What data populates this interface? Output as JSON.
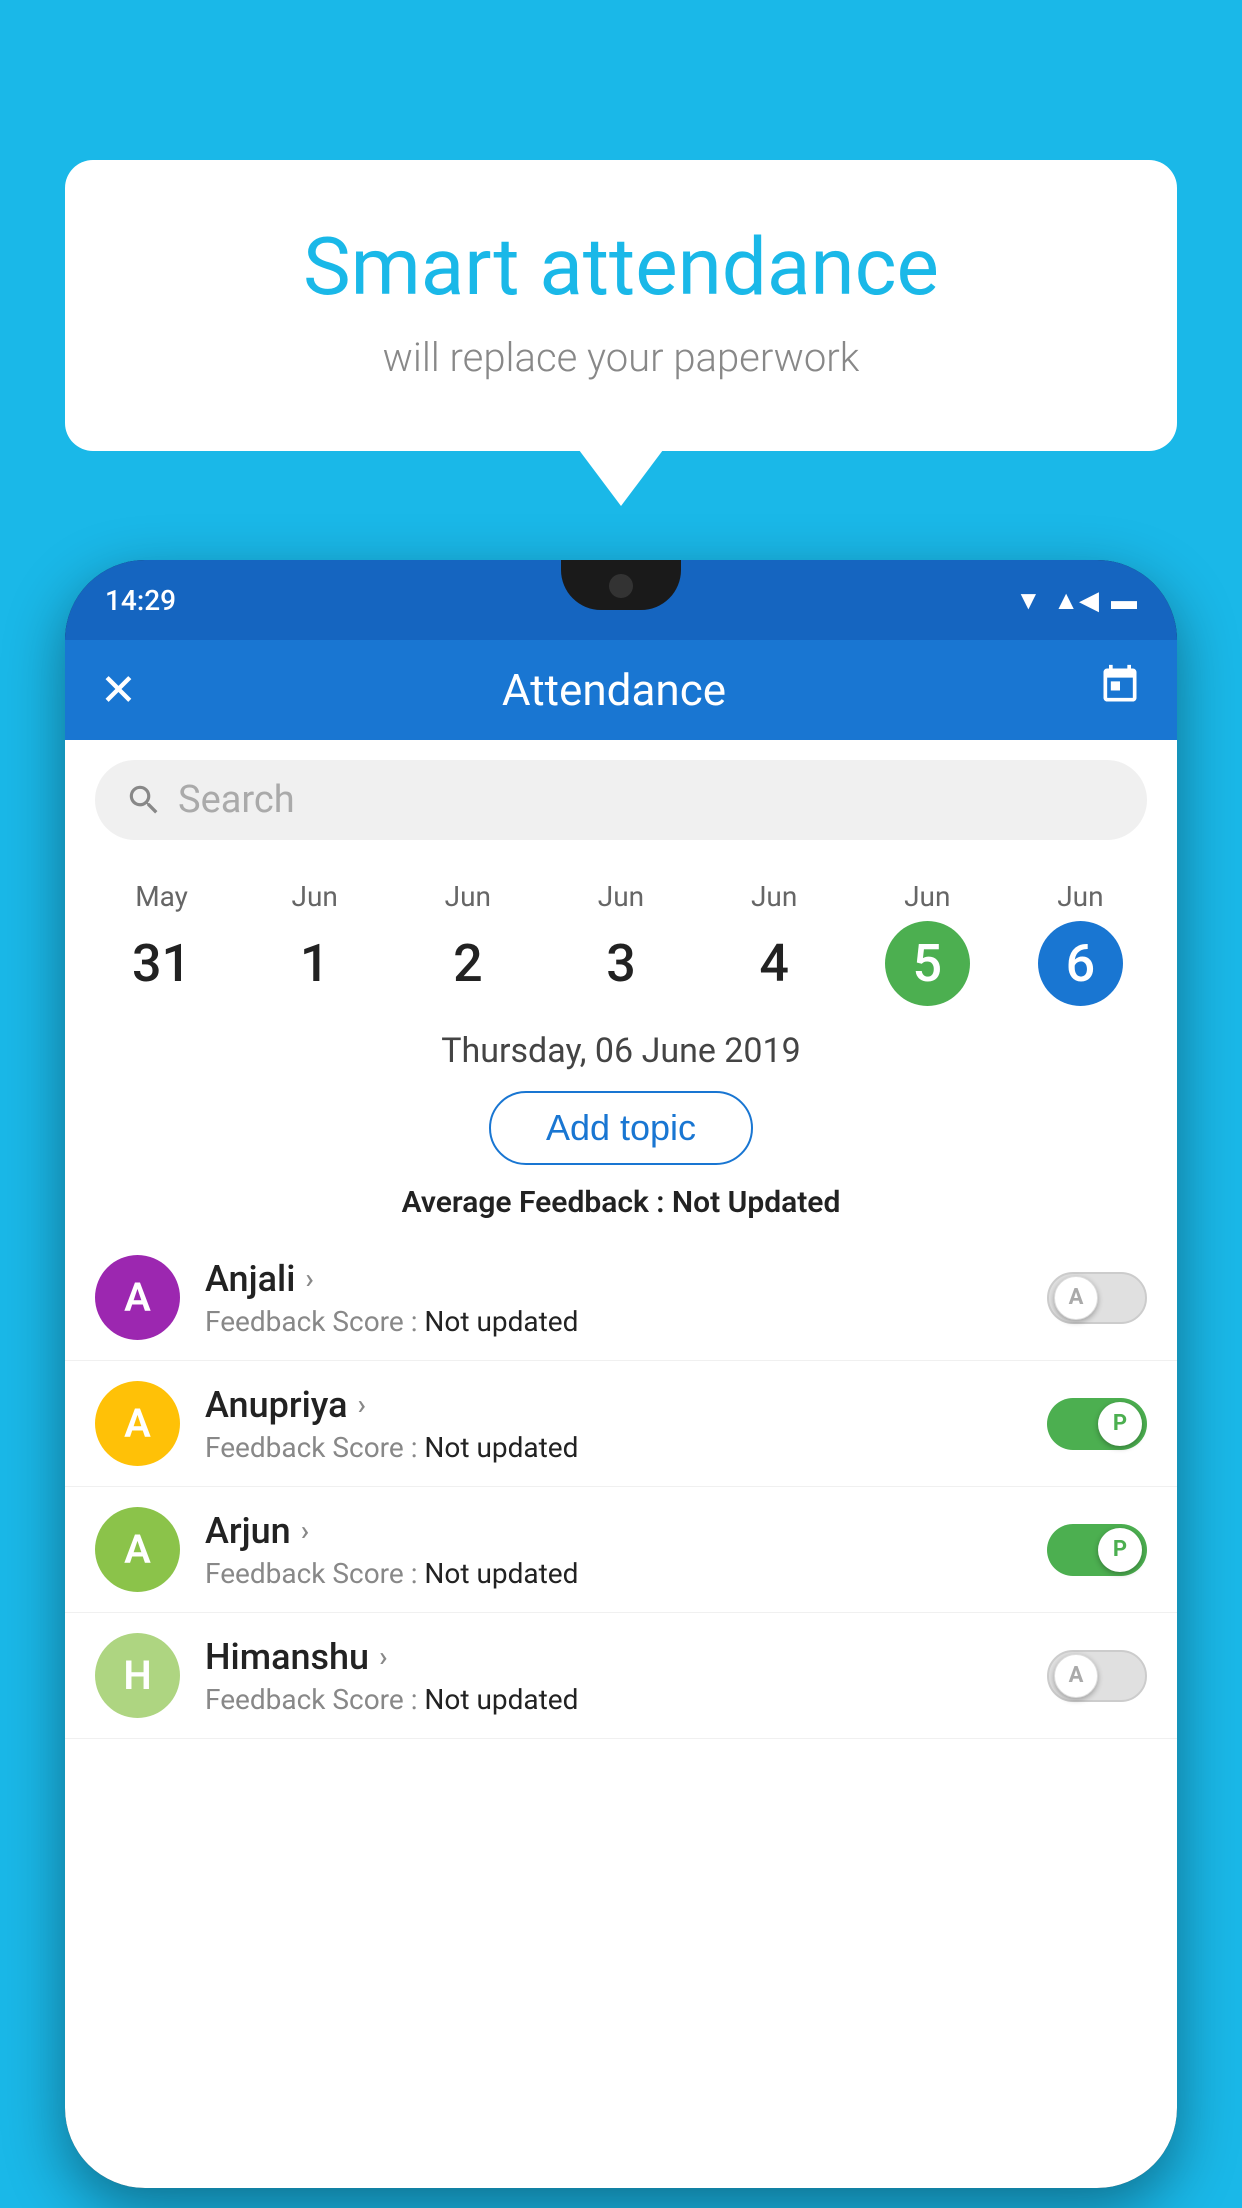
{
  "background": {
    "color": "#1ab8e8"
  },
  "speech_bubble": {
    "title": "Smart attendance",
    "subtitle": "will replace your paperwork"
  },
  "phone": {
    "status_bar": {
      "time": "14:29",
      "wifi": "▼",
      "signal": "▲",
      "battery": "🔋"
    },
    "app_header": {
      "close_label": "✕",
      "title": "Attendance",
      "calendar_icon": "📅"
    },
    "search": {
      "placeholder": "Search"
    },
    "calendar": {
      "days": [
        {
          "month": "May",
          "num": "31",
          "state": "normal"
        },
        {
          "month": "Jun",
          "num": "1",
          "state": "normal"
        },
        {
          "month": "Jun",
          "num": "2",
          "state": "normal"
        },
        {
          "month": "Jun",
          "num": "3",
          "state": "normal"
        },
        {
          "month": "Jun",
          "num": "4",
          "state": "normal"
        },
        {
          "month": "Jun",
          "num": "5",
          "state": "today"
        },
        {
          "month": "Jun",
          "num": "6",
          "state": "selected"
        }
      ]
    },
    "selected_date": "Thursday, 06 June 2019",
    "add_topic_label": "Add topic",
    "avg_feedback_label": "Average Feedback : ",
    "avg_feedback_value": "Not Updated",
    "students": [
      {
        "name": "Anjali",
        "avatar_letter": "A",
        "avatar_color": "#9c27b0",
        "feedback_label": "Feedback Score : ",
        "feedback_value": "Not updated",
        "attendance": "off",
        "attendance_label": "A"
      },
      {
        "name": "Anupriya",
        "avatar_letter": "A",
        "avatar_color": "#ffc107",
        "feedback_label": "Feedback Score : ",
        "feedback_value": "Not updated",
        "attendance": "on",
        "attendance_label": "P"
      },
      {
        "name": "Arjun",
        "avatar_letter": "A",
        "avatar_color": "#8bc34a",
        "feedback_label": "Feedback Score : ",
        "feedback_value": "Not updated",
        "attendance": "on",
        "attendance_label": "P"
      },
      {
        "name": "Himanshu",
        "avatar_letter": "H",
        "avatar_color": "#aed581",
        "feedback_label": "Feedback Score : ",
        "feedback_value": "Not updated",
        "attendance": "off",
        "attendance_label": "A"
      }
    ]
  }
}
